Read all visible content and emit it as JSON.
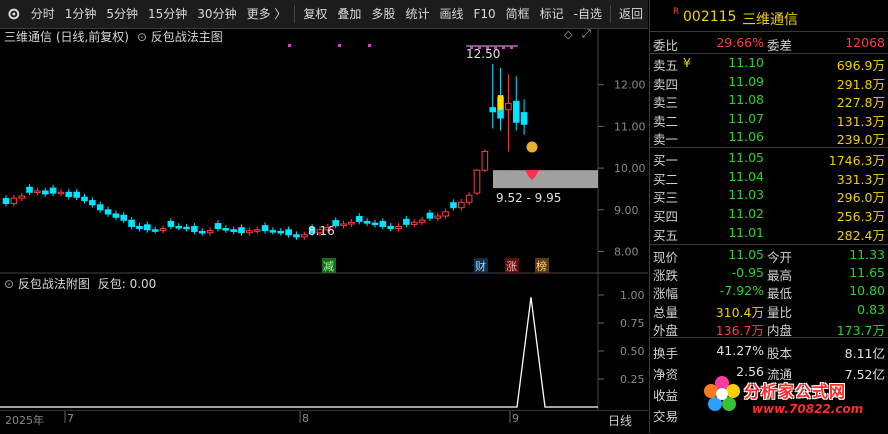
{
  "toolbar": {
    "items": [
      "分时",
      "1分钟",
      "5分钟",
      "15分钟",
      "30分钟",
      "更多 〉",
      "复权",
      "叠加",
      "多股",
      "统计",
      "画线",
      "F10",
      "简框",
      "标记",
      "-自选",
      "返回"
    ]
  },
  "main_panel": {
    "title": "三维通信 (日线,前复权)",
    "indicator": "反包战法主图",
    "price_ticks": [
      "12.00",
      "11.00",
      "10.00",
      "9.00",
      "8.00"
    ],
    "high_marker": "12.50",
    "low_marker": "8.16",
    "band_label": "9.52 - 9.95",
    "event_tags": [
      "减",
      "财",
      "涨",
      "榜"
    ]
  },
  "sub_panel": {
    "title": "反包战法附图",
    "value_label": "反包: 0.00",
    "ticks": [
      "1.00",
      "0.75",
      "0.50",
      "0.25"
    ]
  },
  "time_axis": {
    "labels": [
      "2025年",
      "7",
      "8",
      "9"
    ],
    "period": "日线"
  },
  "quote": {
    "header": {
      "marker": "R",
      "code": "002115",
      "name": "三维通信"
    },
    "ratio": {
      "wb_label": "委比",
      "wb_value": "29.66%",
      "wc_label": "委差",
      "wc_value": "12068"
    },
    "sell": [
      {
        "label": "卖五",
        "mark": "¥",
        "price": "11.10",
        "vol": "696.9万"
      },
      {
        "label": "卖四",
        "mark": "",
        "price": "11.09",
        "vol": "291.8万"
      },
      {
        "label": "卖三",
        "mark": "",
        "price": "11.08",
        "vol": "227.8万"
      },
      {
        "label": "卖二",
        "mark": "",
        "price": "11.07",
        "vol": "131.3万"
      },
      {
        "label": "卖一",
        "mark": "",
        "price": "11.06",
        "vol": "239.0万"
      }
    ],
    "buy": [
      {
        "label": "买一",
        "price": "11.05",
        "vol": "1746.3万"
      },
      {
        "label": "买二",
        "price": "11.04",
        "vol": "331.3万"
      },
      {
        "label": "买三",
        "price": "11.03",
        "vol": "296.0万"
      },
      {
        "label": "买四",
        "price": "11.02",
        "vol": "256.3万"
      },
      {
        "label": "买五",
        "price": "11.01",
        "vol": "282.4万"
      }
    ],
    "stats": [
      {
        "l1": "现价",
        "v1": "11.05",
        "c1": "green",
        "l2": "今开",
        "v2": "11.33",
        "c2": "green"
      },
      {
        "l1": "涨跌",
        "v1": "-0.95",
        "c1": "green",
        "l2": "最高",
        "v2": "11.65",
        "c2": "green"
      },
      {
        "l1": "涨幅",
        "v1": "-7.92%",
        "c1": "green",
        "l2": "最低",
        "v2": "10.80",
        "c2": "green"
      },
      {
        "l1": "总量",
        "v1": "310.4万",
        "c1": "yellow",
        "l2": "量比",
        "v2": "0.83",
        "c2": "green"
      },
      {
        "l1": "外盘",
        "v1": "136.7万",
        "c1": "red",
        "l2": "内盘",
        "v2": "173.7万",
        "c2": "green"
      }
    ],
    "stats2": [
      {
        "l1": "换手",
        "v1": "41.27%",
        "l2": "股本",
        "v2": "8.11亿"
      },
      {
        "l1": "净资",
        "v1": "2.56",
        "l2": "流通",
        "v2": "7.52亿"
      },
      {
        "l1": "收益",
        "v1": "",
        "l2": "",
        "v2": ""
      },
      {
        "l1": "交易",
        "v1": "",
        "l2": "",
        "v2": ""
      }
    ]
  },
  "watermark": {
    "text": "分析家公式网",
    "url": "www.70822.com"
  },
  "colors": {
    "up": "#ff3c3c",
    "down": "#00e5ff",
    "bg": "#000000",
    "band": "#a0a0a0",
    "marker": "#d040d0"
  }
}
